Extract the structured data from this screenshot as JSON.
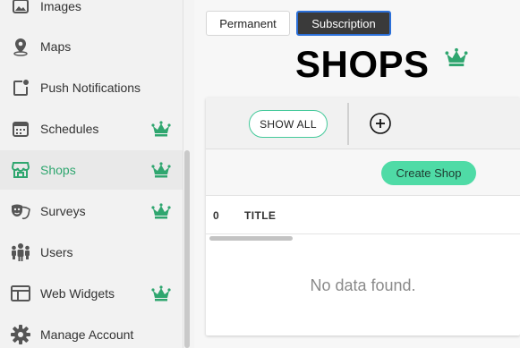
{
  "sidebar": {
    "items": [
      {
        "label": "Images",
        "icon": "images-icon",
        "premium": false,
        "active": false
      },
      {
        "label": "Maps",
        "icon": "map-pin-icon",
        "premium": false,
        "active": false
      },
      {
        "label": "Push Notifications",
        "icon": "push-notification-icon",
        "premium": false,
        "active": false
      },
      {
        "label": "Schedules",
        "icon": "calendar-icon",
        "premium": true,
        "active": false
      },
      {
        "label": "Shops",
        "icon": "shop-icon",
        "premium": true,
        "active": true
      },
      {
        "label": "Surveys",
        "icon": "theater-masks-icon",
        "premium": true,
        "active": false
      },
      {
        "label": "Users",
        "icon": "users-icon",
        "premium": false,
        "active": false
      },
      {
        "label": "Web Widgets",
        "icon": "web-widget-icon",
        "premium": true,
        "active": false
      },
      {
        "label": "Manage Account",
        "icon": "gear-icon",
        "premium": false,
        "active": false
      }
    ]
  },
  "header": {
    "toggle_permanent": "Permanent",
    "toggle_subscription": "Subscription",
    "selected_toggle": "Subscription",
    "title": "SHOPS"
  },
  "toolbar": {
    "show_all": "SHOW ALL",
    "create_shop": "Create Shop"
  },
  "table": {
    "count": "0",
    "column_title": "TITLE",
    "empty_message": "No data found."
  },
  "colors": {
    "accent_green": "#2fa66f",
    "button_green": "#4fdba6",
    "crown_green": "#2fa66f",
    "selected_toggle_bg": "#3a3a3a",
    "selected_toggle_border": "#2b6fd8"
  }
}
